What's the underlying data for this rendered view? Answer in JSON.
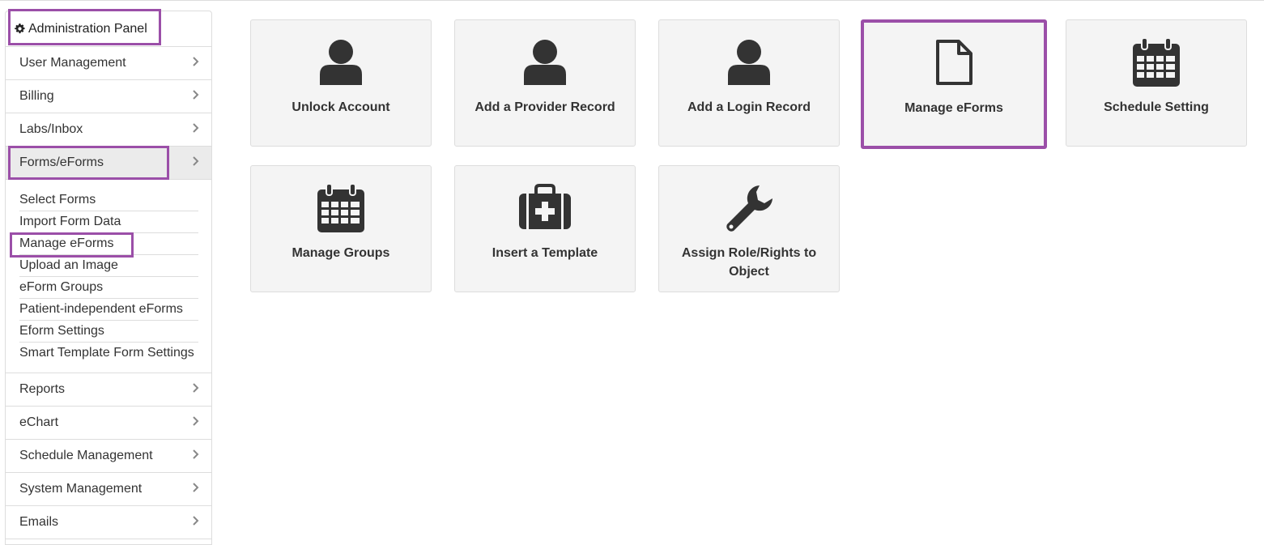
{
  "sidebar": {
    "title": "Administration Panel",
    "title_icon": "gear-icon",
    "items": [
      {
        "label": "User Management"
      },
      {
        "label": "Billing"
      },
      {
        "label": "Labs/Inbox"
      },
      {
        "label": "Forms/eForms",
        "expanded": true
      }
    ],
    "submenu": [
      {
        "label": "Select Forms"
      },
      {
        "label": "Import Form Data"
      },
      {
        "label": "Manage eForms",
        "highlighted": true
      },
      {
        "label": "Upload an Image"
      },
      {
        "label": "eForm Groups"
      },
      {
        "label": "Patient-independent eForms"
      },
      {
        "label": "Eform Settings"
      },
      {
        "label": "Smart Template Form Settings"
      }
    ],
    "items_after": [
      {
        "label": "Reports"
      },
      {
        "label": "eChart"
      },
      {
        "label": "Schedule Management"
      },
      {
        "label": "System Management"
      },
      {
        "label": "Emails"
      }
    ]
  },
  "tiles": [
    {
      "label": "Unlock Account",
      "icon": "user-icon"
    },
    {
      "label": "Add a Provider Record",
      "icon": "user-icon"
    },
    {
      "label": "Add a Login Record",
      "icon": "user-icon"
    },
    {
      "label": "Manage eForms",
      "icon": "document-icon",
      "selected": true
    },
    {
      "label": "Schedule Setting",
      "icon": "calendar-icon"
    },
    {
      "label": "Manage Groups",
      "icon": "calendar-icon"
    },
    {
      "label": "Insert a Template",
      "icon": "medkit-icon"
    },
    {
      "label": "Assign Role/Rights to Object",
      "icon": "wrench-icon"
    }
  ],
  "colors": {
    "highlight": "#9b4fa8",
    "icon": "#333333",
    "tile_bg": "#f4f4f4"
  }
}
